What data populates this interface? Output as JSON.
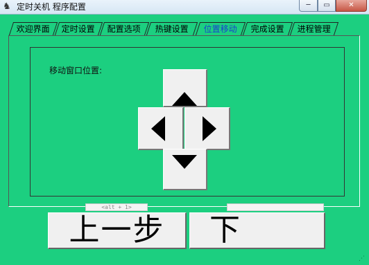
{
  "window": {
    "title": "定时关机 程序配置",
    "app_icon": "app-icon",
    "min_label": "─",
    "max_label": "▭",
    "close_label": "✕"
  },
  "tabs": [
    {
      "label": "欢迎界面"
    },
    {
      "label": "定时设置"
    },
    {
      "label": "配置选项"
    },
    {
      "label": "热键设置"
    },
    {
      "label": "位置移动",
      "active": true
    },
    {
      "label": "完成设置"
    },
    {
      "label": "进程管理"
    }
  ],
  "move_panel": {
    "label": "移动窗口位置:",
    "buttons": {
      "up": "arrow-up-icon",
      "down": "arrow-down-icon",
      "left": "arrow-left-icon",
      "right": "arrow-right-icon"
    }
  },
  "footer": {
    "prev_hint": "<alt + 1>",
    "next_hint": "",
    "prev_label": "上一步",
    "next_label": "下"
  },
  "colors": {
    "background": "#1ccf80",
    "button_face": "#f0f0f0",
    "active_tab_text": "#1a3fd0"
  }
}
